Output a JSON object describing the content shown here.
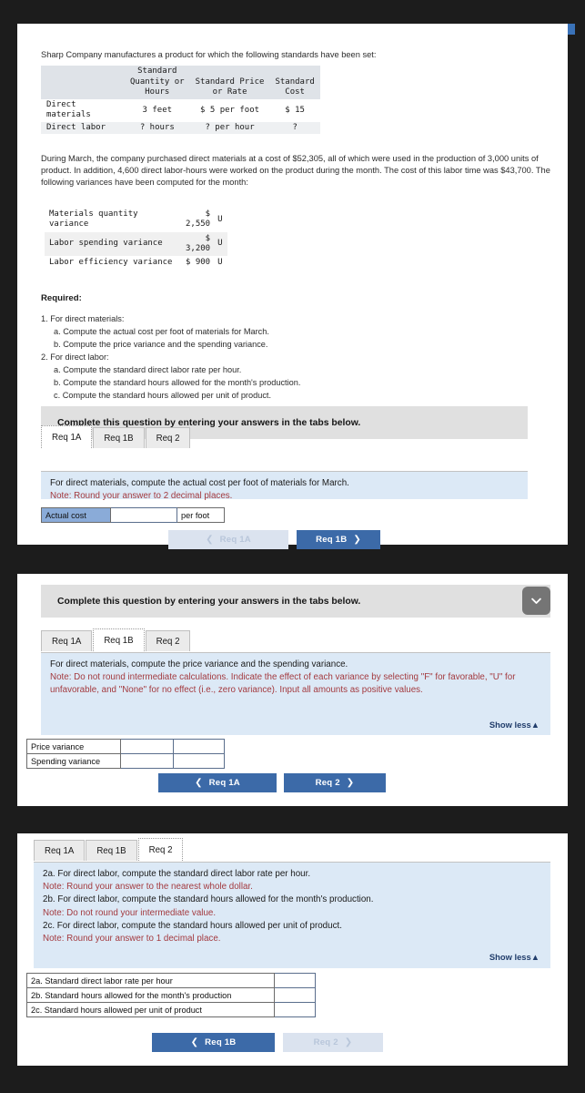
{
  "question": {
    "intro": "Sharp Company manufactures a product for which the following standards have been set:",
    "paragraph": "During March, the company purchased direct materials at a cost of $52,305, all of which were used in the production of 3,000 units of product. In addition, 4,600 direct labor-hours were worked on the product during the month. The cost of this labor time was $43,700. The following variances have been computed for the month:"
  },
  "standards_table": {
    "headers": [
      "",
      "Standard Quantity or Hours",
      "Standard Price or Rate",
      "Standard Cost"
    ],
    "header_lines": {
      "col1": [
        "Standard",
        "Quantity or",
        "Hours"
      ],
      "col2": [
        "Standard Price",
        "or Rate"
      ],
      "col3": [
        "Standard",
        "Cost"
      ]
    },
    "rows": [
      {
        "label": "Direct materials",
        "qty": "3 feet",
        "price": "$ 5 per foot",
        "cost": "$ 15"
      },
      {
        "label": "Direct labor",
        "qty": "? hours",
        "price": "? per hour",
        "cost": "?"
      }
    ]
  },
  "variance_table": {
    "rows": [
      {
        "label": "Materials quantity variance",
        "amount": "$\n2,550",
        "flag": "U"
      },
      {
        "label": "Labor spending variance",
        "amount": "$\n3,200",
        "flag": "U"
      },
      {
        "label": "Labor efficiency variance",
        "amount": "$ 900",
        "flag": "U"
      }
    ]
  },
  "required": {
    "heading": "Required:",
    "items": [
      {
        "level": 1,
        "text": "1. For direct materials:"
      },
      {
        "level": 2,
        "text": "a. Compute the actual cost per foot of materials for March."
      },
      {
        "level": 2,
        "text": "b. Compute the price variance and the spending variance."
      },
      {
        "level": 1,
        "text": "2. For direct labor:"
      },
      {
        "level": 2,
        "text": "a. Compute the standard direct labor rate per hour."
      },
      {
        "level": 2,
        "text": "b. Compute the standard hours allowed for the month's production."
      },
      {
        "level": 2,
        "text": "c. Compute the standard hours allowed per unit of product."
      }
    ]
  },
  "complete_bar": {
    "text": "Complete this question by entering your answers in the tabs below."
  },
  "tabs": {
    "labels": [
      "Req 1A",
      "Req 1B",
      "Req 2"
    ]
  },
  "panel_req1a": {
    "active_tab": "Req 1A",
    "prompt": "For direct materials, compute the actual cost per foot of materials for March.",
    "note": "Note: Round your answer to 2 decimal places.",
    "row_label": "Actual cost",
    "row_unit": "per foot",
    "input_value": "",
    "prev_button": "Req 1A",
    "next_button": "Req 1B"
  },
  "panel_req1b": {
    "active_tab": "Req 1B",
    "prompt": "For direct materials, compute the price variance and the spending variance.",
    "note": "Note: Do not round intermediate calculations. Indicate the effect of each variance by selecting \"F\" for favorable, \"U\" for unfavorable, and \"None\" for no effect (i.e., zero variance). Input all amounts as positive values.",
    "show_less": "Show less",
    "rows": [
      {
        "label": "Price variance",
        "amount": "",
        "effect": ""
      },
      {
        "label": "Spending variance",
        "amount": "",
        "effect": ""
      }
    ],
    "prev_button": "Req 1A",
    "next_button": "Req 2"
  },
  "panel_req2": {
    "active_tab": "Req 2",
    "lines": [
      {
        "kind": "prompt",
        "text": "2a. For direct labor, compute the standard direct labor rate per hour."
      },
      {
        "kind": "note",
        "text": "Note: Round your answer to the nearest whole dollar."
      },
      {
        "kind": "prompt",
        "text": "2b. For direct labor, compute the standard hours allowed for the month's production."
      },
      {
        "kind": "note",
        "text": "Note: Do not round your intermediate value."
      },
      {
        "kind": "prompt",
        "text": "2c. For direct labor, compute the standard hours allowed per unit of product."
      },
      {
        "kind": "note",
        "text": "Note: Round your answer to 1 decimal place."
      }
    ],
    "show_less": "Show less",
    "rows": [
      {
        "label": "2a. Standard direct labor rate per hour",
        "value": ""
      },
      {
        "label": "2b. Standard hours allowed for the month's production",
        "value": ""
      },
      {
        "label": "2c. Standard hours allowed per unit of product",
        "value": ""
      }
    ],
    "prev_button": "Req 1B",
    "next_button": "Req 2"
  },
  "colors": {
    "accent_blue": "#3c6aa8",
    "prompt_bg": "#dce9f6",
    "note_red": "#a33a3f",
    "bar_gray": "#e0e0e0",
    "selected_cell": "#8aabd8"
  }
}
